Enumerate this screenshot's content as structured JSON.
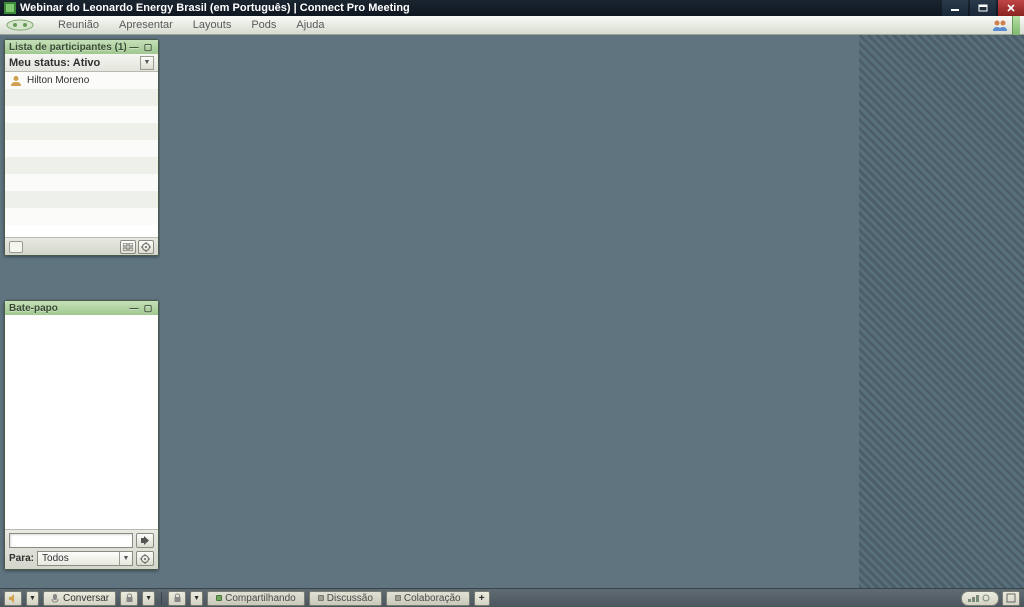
{
  "window": {
    "title": "Webinar do Leonardo Energy Brasil (em Português) | Connect Pro Meeting"
  },
  "menu": {
    "items": [
      "Reunião",
      "Apresentar",
      "Layouts",
      "Pods",
      "Ajuda"
    ]
  },
  "participants_pod": {
    "title": "Lista de participantes (1)",
    "status_label": "Meu status: Ativo",
    "list": [
      {
        "name": "Hilton Moreno",
        "role": "host"
      }
    ]
  },
  "chat_pod": {
    "title": "Bate-papo",
    "to_label": "Para:",
    "to_selected": "Todos"
  },
  "bottom": {
    "conversar": "Conversar",
    "tabs": {
      "compartilhando": "Compartilhando",
      "discussao": "Discussão",
      "colaboracao": "Colaboração"
    }
  }
}
